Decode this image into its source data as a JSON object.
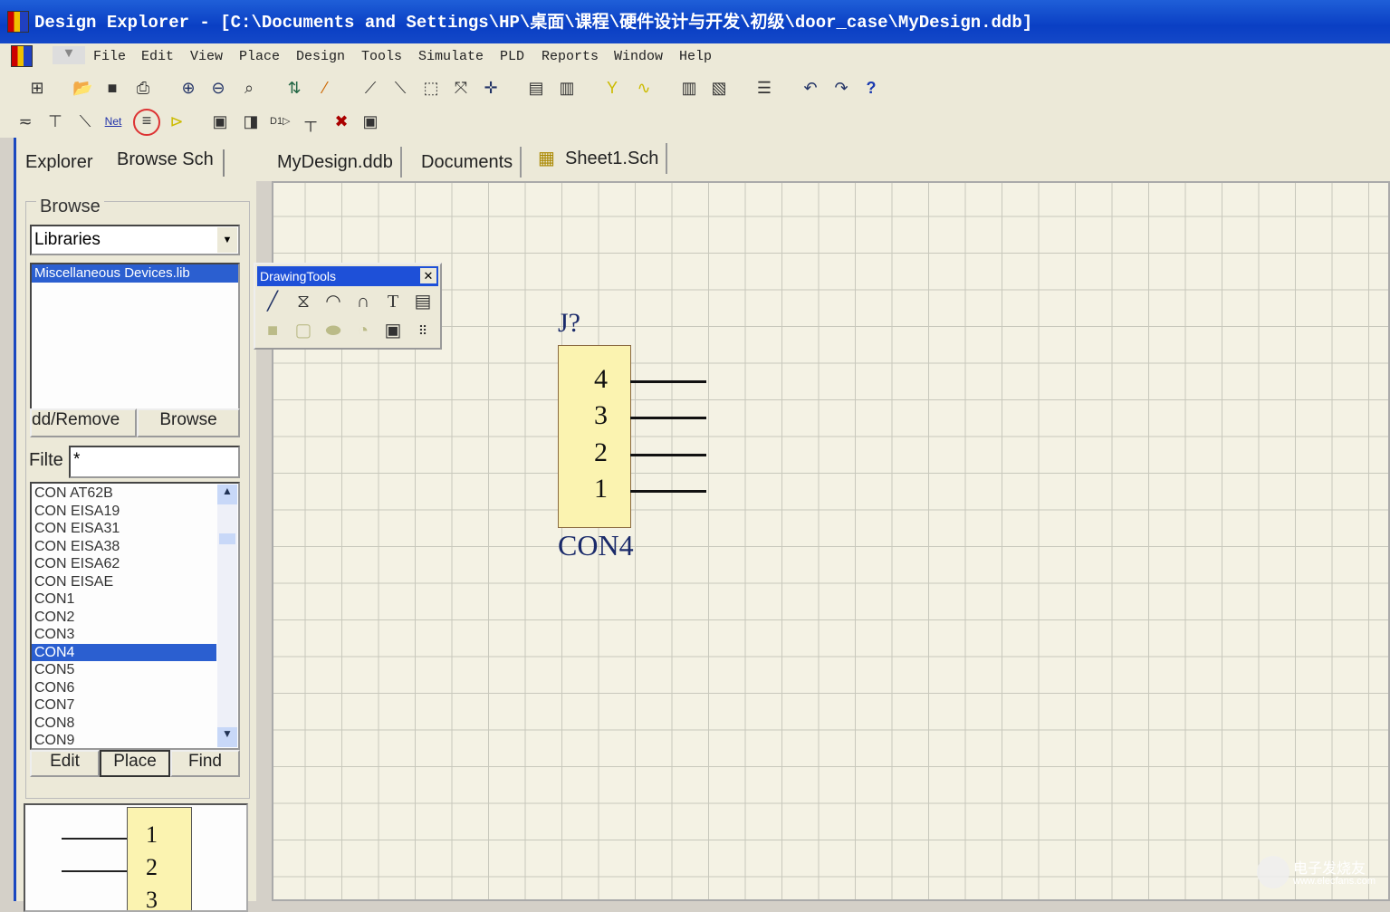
{
  "window": {
    "title": "Design Explorer - [C:\\Documents and Settings\\HP\\桌面\\课程\\硬件设计与开发\\初级\\door_case\\MyDesign.ddb]"
  },
  "menu": [
    "File",
    "Edit",
    "View",
    "Place",
    "Design",
    "Tools",
    "Simulate",
    "PLD",
    "Reports",
    "Window",
    "Help"
  ],
  "left_panel": {
    "tabs": [
      "Explorer",
      "Browse Sch"
    ],
    "browse_label": "Browse",
    "browse_select": "Libraries",
    "libraries": [
      "Miscellaneous Devices.lib"
    ],
    "add_remove": "dd/Remove",
    "browse_button": "Browse",
    "filter_label": "Filte",
    "filter_value": "*",
    "components": [
      "CON AT62B",
      "CON EISA19",
      "CON EISA31",
      "CON EISA38",
      "CON EISA62",
      "CON EISAE",
      "CON1",
      "CON2",
      "CON3",
      "CON4",
      "CON5",
      "CON6",
      "CON7",
      "CON8",
      "CON9"
    ],
    "selected_component": "CON4",
    "edit": "Edit",
    "place": "Place",
    "find": "Find",
    "preview_pins": [
      "1",
      "2",
      "3"
    ]
  },
  "doc_tabs": [
    "MyDesign.ddb",
    "Documents",
    "Sheet1.Sch"
  ],
  "drawing_tools": {
    "title": "DrawingTools"
  },
  "schematic": {
    "designator": "J?",
    "part": "CON4",
    "pins": [
      "4",
      "3",
      "2",
      "1"
    ],
    "body_color": "#fbf3b0"
  },
  "watermark": {
    "cn": "电子发烧友",
    "url": "www.elecfans.com"
  }
}
